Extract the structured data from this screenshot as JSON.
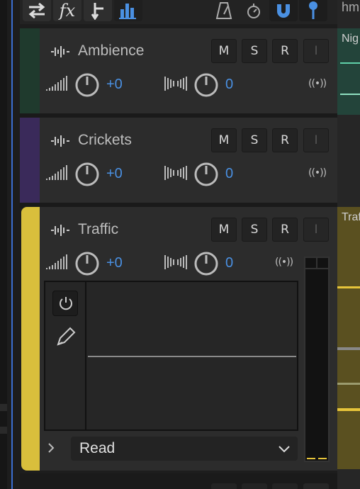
{
  "toolbar": {
    "buttons": [
      "swap-icon",
      "fx-icon",
      "split-icon",
      "bars-icon"
    ],
    "right_buttons": [
      "metronome-icon",
      "timer-icon",
      "magnet-icon",
      "pin-icon"
    ],
    "right_text": "hm"
  },
  "tracks": [
    {
      "name": "Ambience",
      "color": "#1f3a2d",
      "volume": "+0",
      "pan": "0",
      "m": "M",
      "s": "S",
      "r": "R",
      "i": "I",
      "clip_label": "Nig"
    },
    {
      "name": "Crickets",
      "color": "#3a2a5a",
      "volume": "+0",
      "pan": "0",
      "m": "M",
      "s": "S",
      "r": "R",
      "i": "I",
      "clip_label": ""
    },
    {
      "name": "Traffic",
      "color": "#d9bf3c",
      "volume": "+0",
      "pan": "0",
      "m": "M",
      "s": "S",
      "r": "R",
      "i": "I",
      "clip_label": "Traf"
    }
  ],
  "automation": {
    "mode": "Read"
  },
  "colors": {
    "accent": "#4a90e2",
    "traffic_yellow": "#d9bf3c",
    "clip_green": "#2f6e56"
  }
}
